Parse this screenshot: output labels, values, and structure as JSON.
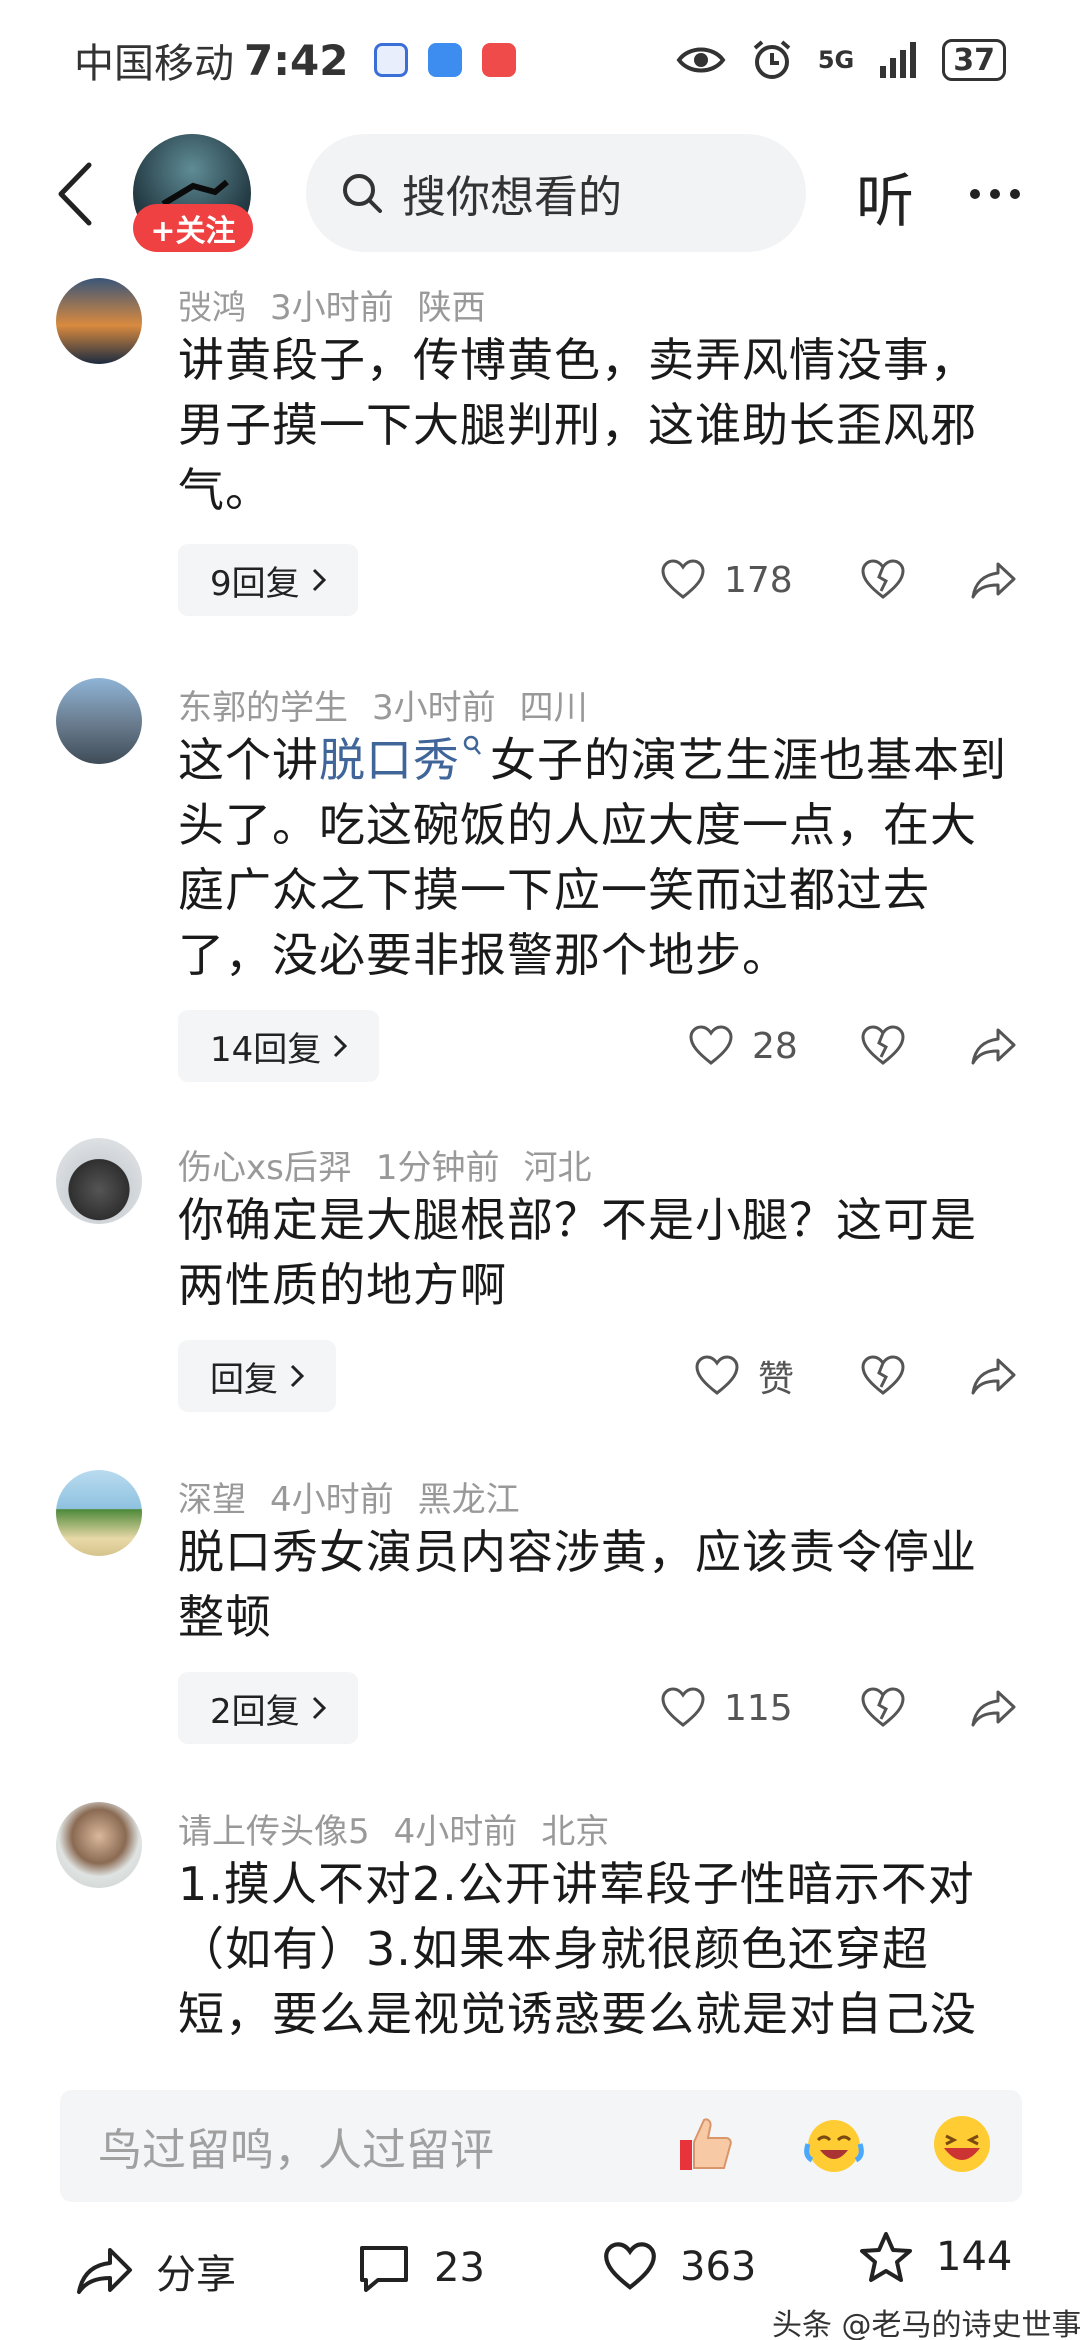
{
  "status_bar": {
    "carrier": "中国移动",
    "time": "7:42",
    "network": "5G",
    "battery": "37"
  },
  "header": {
    "follow_label": "+关注",
    "search_placeholder": "搜你想看的",
    "listen_label": "听"
  },
  "comments": [
    {
      "user": "弢鸿",
      "time": "3小时前",
      "location": "陕西",
      "text": "讲黄段子，传博黄色，卖弄风情没事，男子摸一下大腿判刑，这谁助长歪风邪气。",
      "replies": "9回复",
      "likes": "178"
    },
    {
      "user": "东郭的学生",
      "time": "3小时前",
      "location": "四川",
      "text_before": "这个讲",
      "text_link": "脱口秀",
      "text_after": "女子的演艺生涯也基本到头了。吃这碗饭的人应大度一点，在大庭广众之下摸一下应一笑而过都过去了，没必要非报警那个地步。",
      "replies": "14回复",
      "likes": "28"
    },
    {
      "user": "伤心xs后羿",
      "time": "1分钟前",
      "location": "河北",
      "text": "你确定是大腿根部？不是小腿？这可是两性质的地方啊",
      "replies": "回复",
      "likes": "赞"
    },
    {
      "user": "深望",
      "time": "4小时前",
      "location": "黑龙江",
      "text": "脱口秀女演员内容涉黄，应该责令停业整顿",
      "replies": "2回复",
      "likes": "115"
    },
    {
      "user": "请上传头像5",
      "time": "4小时前",
      "location": "北京",
      "text": "1.摸人不对2.公开讲荤段子性暗示不对（如有）3.如果本身就很颜色还穿超短，要么是视觉诱惑要么就是对自己没"
    }
  ],
  "input": {
    "placeholder": "鸟过留鸣，人过留评"
  },
  "bottom_bar": {
    "share_label": "分享",
    "comment_count": "23",
    "like_count": "363",
    "favorite_count": "144"
  },
  "watermark": "头条 @老马的诗史世事",
  "colors": {
    "accent_red": "#f04142",
    "link_blue": "#406599",
    "meta_gray": "#999999"
  }
}
